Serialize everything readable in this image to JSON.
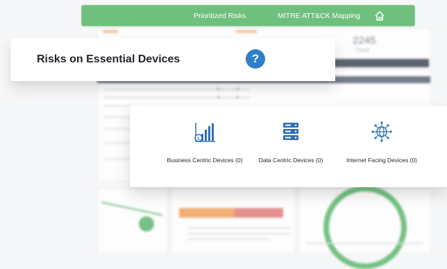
{
  "topnav": {
    "links": [
      "Prioritized Risks",
      "MITRE ATT&CK Mapping"
    ],
    "home_icon": "home-icon"
  },
  "title_card": {
    "title": "Risks on Essential Devices",
    "help_glyph": "?",
    "help_icon": "help-icon"
  },
  "categories": [
    {
      "label": "Business Centric Devices (0)",
      "icon": "business-chart-icon"
    },
    {
      "label": "Data Centric Devices (0)",
      "icon": "database-icon"
    },
    {
      "label": "Internet Facing Devices (0)",
      "icon": "network-globe-icon"
    }
  ],
  "background": {
    "stat_value": "2245",
    "stat_label": "Track"
  },
  "colors": {
    "nav_green": "#6fc07c",
    "help_blue": "#2f7fc8",
    "icon_blue": "#2d6fb3"
  }
}
